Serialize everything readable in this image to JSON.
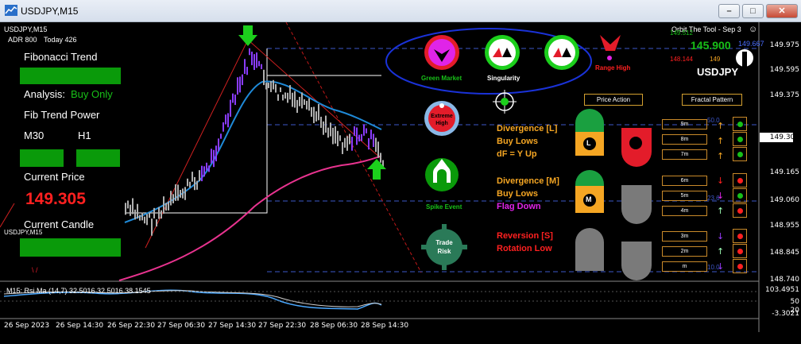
{
  "window": {
    "title": "USDJPY,M15",
    "buttons": [
      "–",
      "□",
      "✕"
    ]
  },
  "chart": {
    "symbol_label": "USDJPY,M15",
    "adr": "ADR 800",
    "today": "Today 426",
    "fib_trend": "Fibonacci Trend",
    "analysis_label": "Analysis:",
    "analysis_value": "Buy Only",
    "fib_power": "Fib Trend Power",
    "m30": "M30",
    "h1": "H1",
    "current_price_label": "Current Price",
    "current_price": "149.305",
    "current_candle": "Current Candle",
    "corner_symbol": "USDJPY,M15",
    "corner_marker": "\\ /"
  },
  "dashboard": {
    "header": "Orbit The Tool - Sep 3",
    "price_big": "145.900",
    "price_small": "149.667",
    "left_top": "149.512",
    "left_bottom": "148.144",
    "mid_small": "149",
    "pair": "USDJPY",
    "green_market": "Green Market",
    "singularity": "Singularity",
    "range_high": "Range High",
    "extreme_high": "Extreme High",
    "spike_event": "Spike Event",
    "trade_risk": "Trade Risk",
    "price_action": "Price Action",
    "fractal_pattern": "Fractal Pattern",
    "div_l": "Divergence [L]",
    "div_l_1": "Buy Lows",
    "div_l_2": "dF = Y Up",
    "div_m": "Divergence [M]",
    "div_m_1": "Buy Lows",
    "div_m_2": "Flag Down",
    "rev_s": "Reversion [S]",
    "rev_s_1": "Rotation Low",
    "tf_rows": [
      "9m",
      "8m",
      "7m",
      "6m",
      "5m",
      "4m",
      "3m",
      "2m",
      "m"
    ],
    "l_badge": "L",
    "m_badge": "M",
    "fib_levels": [
      "50.0",
      "23.6",
      "10.0"
    ]
  },
  "price_axis": [
    "149.975",
    "149.595",
    "149.375",
    "149.305",
    "149.165",
    "149.060",
    "148.955",
    "148.845",
    "148.740"
  ],
  "indicator": {
    "label": "M15: Rsi Ma (14,7) 32.5016 32.5016 38.1545",
    "axis": [
      "103.4951",
      "50",
      "20",
      "-3.3021"
    ]
  },
  "time_axis": [
    "26 Sep 2023",
    "26 Sep 14:30",
    "26 Sep 22:30",
    "27 Sep 06:30",
    "27 Sep 14:30",
    "27 Sep 22:30",
    "28 Sep 06:30",
    "28 Sep 14:30"
  ],
  "colors": {
    "purple_candle": "#8a3cff",
    "gray_candle": "#b0b0b0",
    "ma_blue": "#1f8ad8",
    "ma_pink": "#e8338f",
    "green_text": "#18c018",
    "orange_text": "#f5a623",
    "red_text": "#ff2020"
  }
}
